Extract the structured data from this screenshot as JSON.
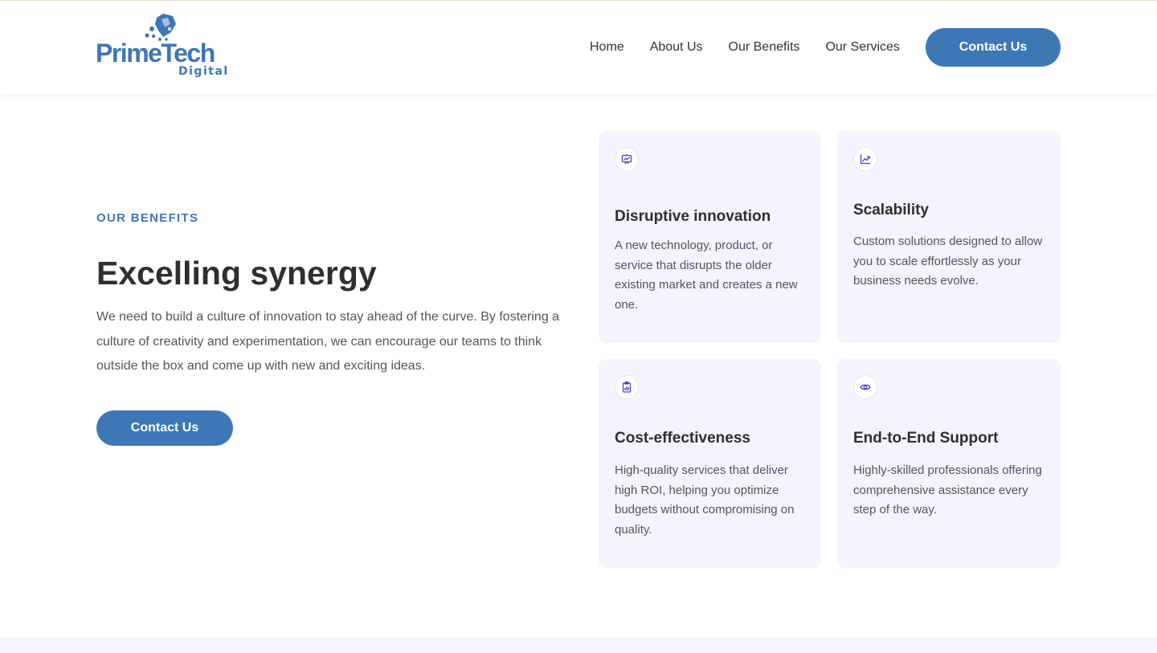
{
  "brand": {
    "name": "PrimeTech",
    "tagline": "Digital",
    "color": "#3d77b6"
  },
  "nav": {
    "items": [
      "Home",
      "About Us",
      "Our Benefits",
      "Our Services"
    ],
    "cta": "Contact Us"
  },
  "hero": {
    "eyebrow": "OUR BENEFITS",
    "title": "Excelling synergy",
    "body": "We need to build a culture of innovation to stay ahead of the curve. By fostering a culture of creativity and experimentation, we can encourage our teams to think outside the box and come up with new and exciting ideas.",
    "cta": "Contact Us"
  },
  "benefits": [
    {
      "icon": "presentation-chart-icon",
      "title": "Disruptive innovation",
      "text": "A new technology, product, or service that disrupts the older existing market and creates a new one."
    },
    {
      "icon": "trend-up-icon",
      "title": "Scalability",
      "text": "Custom solutions designed to allow you to scale effortlessly as your business needs evolve."
    },
    {
      "icon": "clipboard-chart-icon",
      "title": "Cost-effectiveness",
      "text": "High-quality services that deliver high ROI, helping you optimize budgets without compromising on quality."
    },
    {
      "icon": "eye-icon",
      "title": "End-to-End Support",
      "text": "Highly-skilled professionals offering comprehensive assistance every step of the way."
    }
  ],
  "colors": {
    "accent": "#3d77b6",
    "card_bg": "#f4f3fe",
    "icon": "#4a3fd6"
  }
}
